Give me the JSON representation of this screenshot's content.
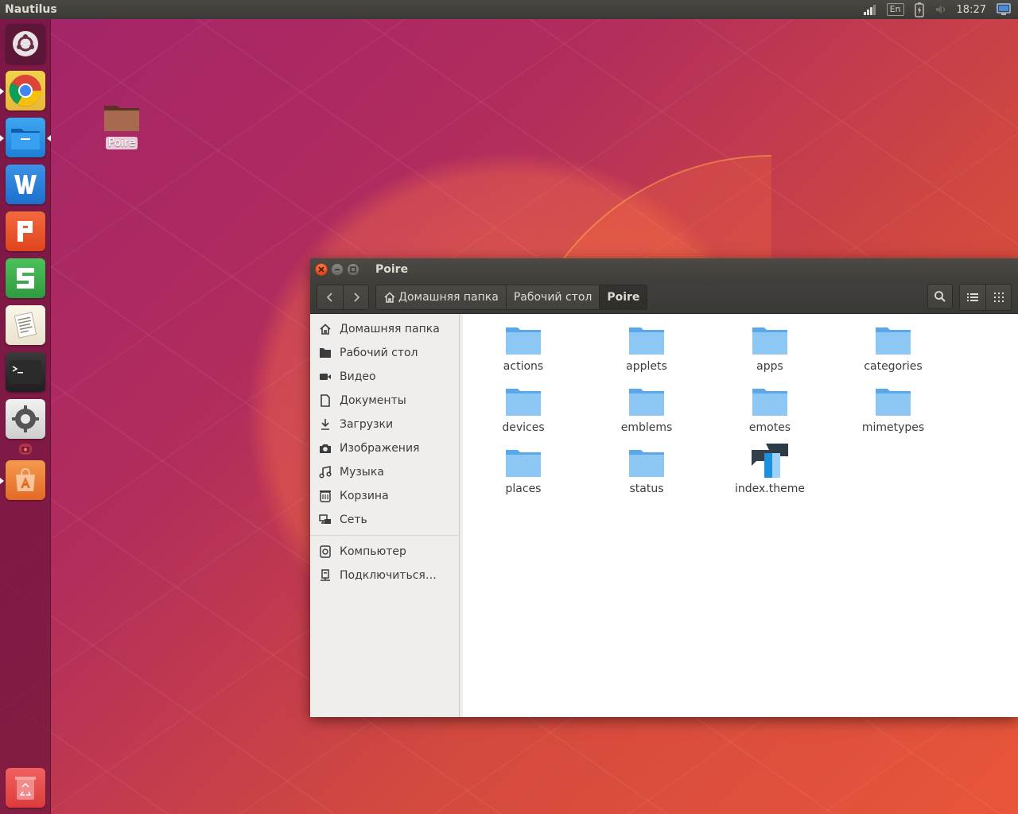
{
  "top_panel": {
    "app_title": "Nautilus",
    "keyboard_layout": "En",
    "clock": "18:27",
    "indicators": [
      "network-icon",
      "keyboard-icon",
      "battery-icon",
      "sound-icon",
      "session-icon"
    ]
  },
  "launcher": {
    "items": [
      {
        "name": "ubuntu-dash-icon",
        "color": "#6b3a4f"
      },
      {
        "name": "chrome-icon",
        "color": "#e0e0e0"
      },
      {
        "name": "files-icon",
        "color": "#1f8fe0"
      },
      {
        "name": "wps-writer-icon",
        "color": "#1f78d1"
      },
      {
        "name": "wps-presentation-icon",
        "color": "#e9522b"
      },
      {
        "name": "wps-spreadsheets-icon",
        "color": "#3aa94a"
      },
      {
        "name": "text-editor-icon",
        "color": "#f3efe2"
      },
      {
        "name": "terminal-icon",
        "color": "#2b2b2b"
      },
      {
        "name": "system-settings-icon",
        "color": "#e8e8e8"
      },
      {
        "name": "software-center-icon",
        "color": "#f07f3a"
      },
      {
        "name": "trash-icon",
        "color": "#e94b4b"
      }
    ]
  },
  "desktop": {
    "folder_label": "Poire"
  },
  "window": {
    "title": "Poire",
    "breadcrumbs": [
      {
        "label": "Домашняя папка",
        "home": true
      },
      {
        "label": "Рабочий стол"
      },
      {
        "label": "Poire",
        "active": true
      }
    ],
    "sidebar": {
      "places": [
        {
          "label": "Домашняя папка",
          "icon": "home-icon"
        },
        {
          "label": "Рабочий стол",
          "icon": "desktop-folder-icon"
        },
        {
          "label": "Видео",
          "icon": "video-icon"
        },
        {
          "label": "Документы",
          "icon": "document-icon"
        },
        {
          "label": "Загрузки",
          "icon": "download-icon"
        },
        {
          "label": "Изображения",
          "icon": "camera-icon"
        },
        {
          "label": "Музыка",
          "icon": "music-icon"
        },
        {
          "label": "Корзина",
          "icon": "trash-icon"
        },
        {
          "label": "Сеть",
          "icon": "network-icon"
        }
      ],
      "devices": [
        {
          "label": "Компьютер",
          "icon": "computer-icon"
        },
        {
          "label": "Подключиться…",
          "icon": "connect-server-icon"
        }
      ]
    },
    "files": [
      {
        "label": "actions",
        "type": "folder"
      },
      {
        "label": "applets",
        "type": "folder"
      },
      {
        "label": "apps",
        "type": "folder"
      },
      {
        "label": "categories",
        "type": "folder"
      },
      {
        "label": "devices",
        "type": "folder"
      },
      {
        "label": "emblems",
        "type": "folder"
      },
      {
        "label": "emotes",
        "type": "folder"
      },
      {
        "label": "mimetypes",
        "type": "folder"
      },
      {
        "label": "places",
        "type": "folder"
      },
      {
        "label": "status",
        "type": "folder"
      },
      {
        "label": "index.theme",
        "type": "theme-file"
      }
    ]
  }
}
